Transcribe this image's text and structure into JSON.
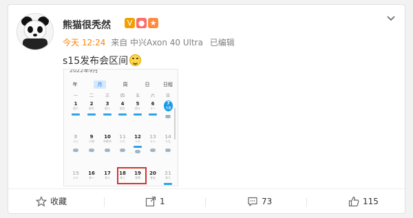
{
  "post": {
    "author": "熊猫很秃然",
    "time": "今天 12:24",
    "source": "来自 中兴Axon 40 Ultra",
    "edited": "已编辑",
    "text": "s15发布会区间",
    "verified_badge": "V"
  },
  "calendar": {
    "header_text": "2022年9月",
    "view_tabs": [
      "年",
      "月",
      "周",
      "日",
      "日程"
    ],
    "selected_tab": "月",
    "weekdays": [
      "一",
      "二",
      "三",
      "四",
      "五",
      "六",
      "日"
    ],
    "weeks": [
      [
        {
          "n": "1",
          "s": "初六"
        },
        {
          "n": "2",
          "s": "初七"
        },
        {
          "n": "3",
          "s": "初八"
        },
        {
          "n": "4",
          "s": "初九"
        },
        {
          "n": "5",
          "s": "初十"
        },
        {
          "n": "6",
          "s": "十一"
        },
        {
          "n": "7",
          "s": "白露"
        }
      ],
      [
        {
          "n": "8",
          "s": "十三"
        },
        {
          "n": "9",
          "s": "十四"
        },
        {
          "n": "10",
          "s": "中秋节"
        },
        {
          "n": "11",
          "s": "十六"
        },
        {
          "n": "12",
          "s": "十七"
        },
        {
          "n": "13",
          "s": "十八"
        },
        {
          "n": "14",
          "s": "十九"
        }
      ],
      [
        {
          "n": "15",
          "s": "二十"
        },
        {
          "n": "16",
          "s": "廿一"
        },
        {
          "n": "17",
          "s": "廿二"
        },
        {
          "n": "18",
          "s": "廿三"
        },
        {
          "n": "19",
          "s": "廿四"
        },
        {
          "n": "20",
          "s": "廿五"
        },
        {
          "n": "21",
          "s": "廿六"
        }
      ]
    ],
    "highlighted_days": [
      "18",
      "19"
    ],
    "today": "7",
    "accent_color": "#1a9be8",
    "highlight_color": "#d0342c"
  },
  "footer": {
    "favorite_label": "收藏",
    "repost_count": "1",
    "comment_count": "73",
    "like_count": "115"
  },
  "icons": {
    "favorite": "star-icon",
    "repost": "share-icon",
    "comment": "comment-icon",
    "like": "thumbs-up-icon",
    "menu": "chevron-down-icon"
  }
}
